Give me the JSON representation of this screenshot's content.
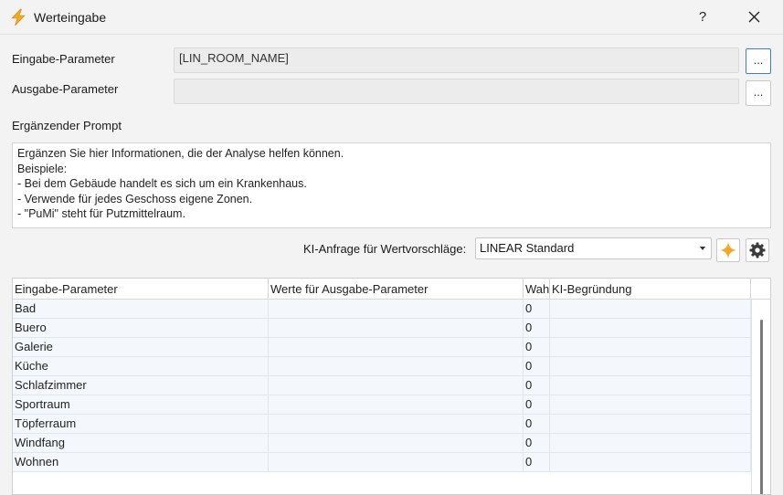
{
  "window": {
    "title": "Werteingabe",
    "help_label": "?"
  },
  "icons": {
    "app": "lightning-bolt-icon",
    "close": "close-icon",
    "ai": "sparkle-icon",
    "settings": "gear-icon",
    "dropdown": "chevron-down-icon"
  },
  "colors": {
    "accent": "#f5a623",
    "row_bg": "#f4f8fc"
  },
  "input": {
    "label": "Eingabe-Parameter",
    "value": "[LIN_ROOM_NAME]",
    "browse_label": "..."
  },
  "output": {
    "label": "Ausgabe-Parameter",
    "value": "",
    "browse_label": "..."
  },
  "prompt": {
    "label": "Ergänzender Prompt",
    "lines": [
      "Ergänzen Sie hier Informationen, die der Analyse helfen können.",
      "Beispiele:",
      "- Bei dem Gebäude handelt es sich um ein Krankenhaus.",
      "- Verwende für jedes Geschoss eigene Zonen.",
      "- \"PuMi\" steht für Putzmittelraum."
    ]
  },
  "ai_request": {
    "label": "KI-Anfrage für Wertvorschläge:",
    "selected": "LINEAR Standard"
  },
  "table": {
    "columns": [
      "Eingabe-Parameter",
      "Werte für Ausgabe-Parameter",
      "Wahrscheinlichkeit",
      "KI-Begründung"
    ],
    "rows": [
      [
        "Bad",
        "",
        "0",
        ""
      ],
      [
        "Buero",
        "",
        "0",
        ""
      ],
      [
        "Galerie",
        "",
        "0",
        ""
      ],
      [
        "Küche",
        "",
        "0",
        ""
      ],
      [
        "Schlafzimmer",
        "",
        "0",
        ""
      ],
      [
        "Sportraum",
        "",
        "0",
        ""
      ],
      [
        "Töpferraum",
        "",
        "0",
        ""
      ],
      [
        "Windfang",
        "",
        "0",
        ""
      ],
      [
        "Wohnen",
        "",
        "0",
        ""
      ]
    ]
  }
}
